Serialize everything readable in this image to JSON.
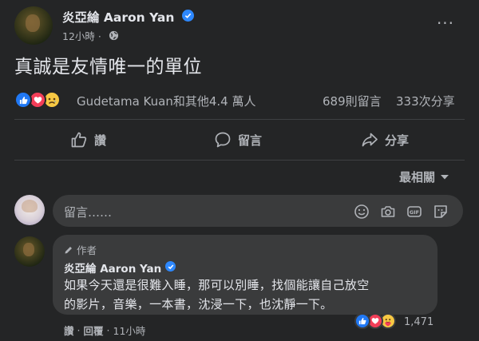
{
  "post": {
    "author": "炎亞綸 Aaron Yan",
    "time": "12小時",
    "text": "真誠是友情唯一的單位",
    "more_label": "···"
  },
  "reactions": {
    "summary": "Gudetama Kuan和其他4.4 萬人",
    "comments": "689則留言",
    "shares": "333次分享",
    "icons": [
      "like-icon",
      "love-icon",
      "sad-icon"
    ]
  },
  "actions": {
    "like": "讚",
    "comment": "留言",
    "share": "分享"
  },
  "sort": {
    "label": "最相關"
  },
  "composer": {
    "placeholder": "留言……",
    "tools": [
      "emoji-icon",
      "camera-icon",
      "gif-icon",
      "sticker-icon"
    ]
  },
  "comment": {
    "badge": "作者",
    "author": "炎亞綸 Aaron Yan",
    "lines": [
      "如果今天還是很難入睡，那可以別睡，找個能讓自己放空",
      "的影片，音樂，一本書，沈浸一下，也沈靜一下。"
    ],
    "reaction_count": "1,471",
    "like_label": "讚",
    "separator": " · ",
    "reply_label": "回覆",
    "time": "11小時"
  },
  "colors": {
    "background": "#242526",
    "bubble": "#3a3b3c",
    "primary_text": "#e4e6eb",
    "secondary_text": "#b0b3b8",
    "verified": "#2d88ff",
    "like": "#2078f4",
    "love": "#f33e58",
    "sad": "#f7c843"
  }
}
